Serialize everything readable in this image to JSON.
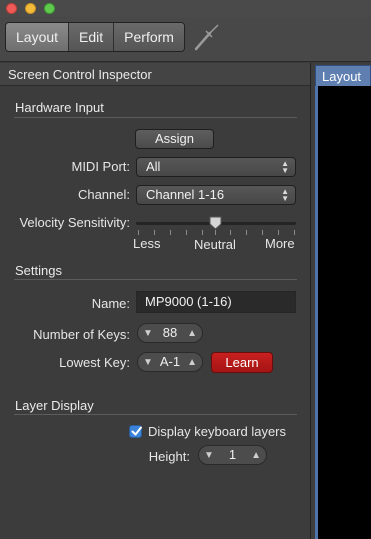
{
  "window": {
    "controls": [
      "close",
      "minimize",
      "zoom"
    ]
  },
  "toolbar": {
    "tabs": [
      {
        "label": "Layout",
        "active": true
      },
      {
        "label": "Edit",
        "active": false
      },
      {
        "label": "Perform",
        "active": false
      }
    ],
    "tool_icon": "wrench-tool-icon"
  },
  "inspector": {
    "title": "Screen Control Inspector",
    "hardware_input": {
      "heading": "Hardware Input",
      "assign_label": "Assign",
      "midi_port": {
        "label": "MIDI Port:",
        "value": "All"
      },
      "channel": {
        "label": "Channel:",
        "value": "Channel 1-16"
      },
      "velocity": {
        "label": "Velocity Sensitivity:",
        "min_label": "Less",
        "mid_label": "Neutral",
        "max_label": "More",
        "level": 0.5
      }
    },
    "settings": {
      "heading": "Settings",
      "name": {
        "label": "Name:",
        "value": "MP9000 (1-16)"
      },
      "num_keys": {
        "label": "Number of Keys:",
        "value": "88"
      },
      "lowest_key": {
        "label": "Lowest Key:",
        "value": "A-1",
        "learn_label": "Learn"
      }
    },
    "layer_display": {
      "heading": "Layer Display",
      "display_layers": {
        "label": "Display keyboard layers",
        "checked": true
      },
      "height": {
        "label": "Height:",
        "value": "1"
      }
    }
  },
  "layout_pane": {
    "tab_label": "Layout"
  },
  "colors": {
    "accent": "#3b83d9",
    "learn": "#c01b1b",
    "layout_tab": "#5f7fb0"
  }
}
